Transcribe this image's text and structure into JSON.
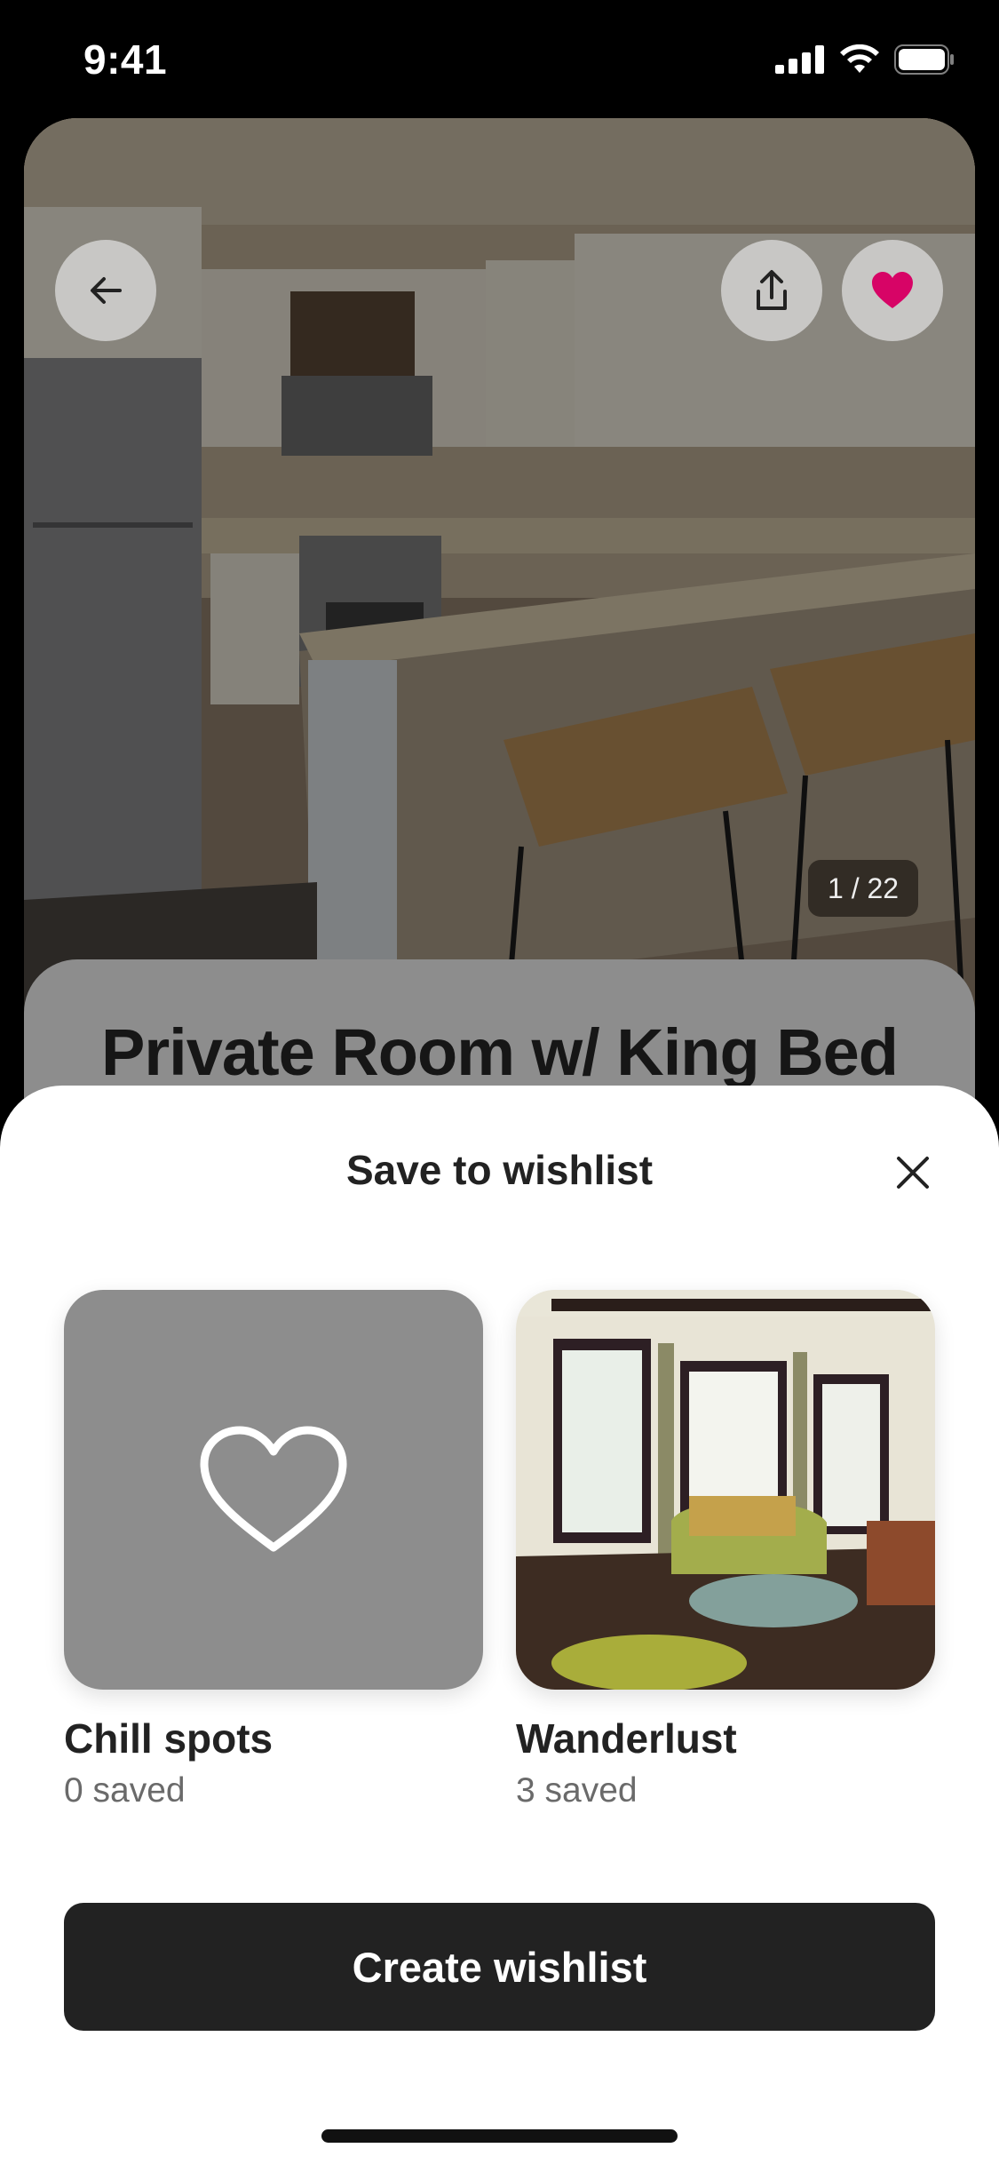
{
  "status_bar": {
    "time": "9:41"
  },
  "listing": {
    "title": "Private Room w/ King Bed",
    "photo_counter": "1 / 22",
    "favorite_color": "#D70466"
  },
  "sheet": {
    "title": "Save to wishlist",
    "wishlists": [
      {
        "name": "Chill spots",
        "count": "0 saved"
      },
      {
        "name": "Wanderlust",
        "count": "3 saved"
      }
    ],
    "create_label": "Create wishlist"
  },
  "icons": [
    "back-arrow-icon",
    "share-icon",
    "heart-filled-icon",
    "close-icon",
    "heart-outline-icon",
    "cellular-icon",
    "wifi-icon",
    "battery-icon"
  ]
}
